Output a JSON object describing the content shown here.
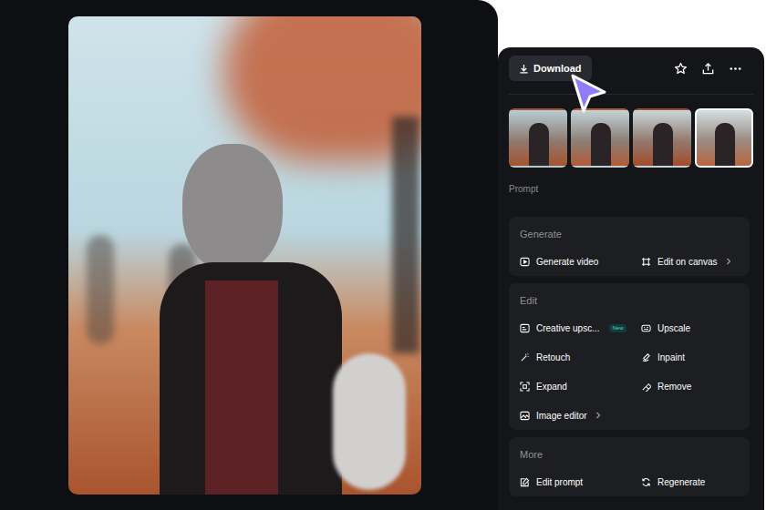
{
  "toolbar": {
    "download": "Download"
  },
  "thumbnails": [
    {
      "selected": false
    },
    {
      "selected": false
    },
    {
      "selected": false
    },
    {
      "selected": true
    }
  ],
  "prompt_label": "Prompt",
  "sections": [
    {
      "title": "Generate",
      "actions": [
        {
          "label": "Generate video",
          "kind": "action"
        },
        {
          "label": "Edit on canvas",
          "kind": "submenu"
        }
      ]
    },
    {
      "title": "Edit",
      "actions": [
        {
          "label": "Creative upsc...",
          "kind": "badged",
          "badge": "New"
        },
        {
          "label": "Upscale",
          "kind": "action"
        },
        {
          "label": "Retouch",
          "kind": "action"
        },
        {
          "label": "Inpaint",
          "kind": "action"
        },
        {
          "label": "Expand",
          "kind": "action"
        },
        {
          "label": "Remove",
          "kind": "action"
        },
        {
          "label": "Image editor",
          "kind": "submenu"
        }
      ]
    },
    {
      "title": "More",
      "actions": [
        {
          "label": "Edit prompt",
          "kind": "action"
        },
        {
          "label": "Regenerate",
          "kind": "action"
        }
      ]
    }
  ]
}
